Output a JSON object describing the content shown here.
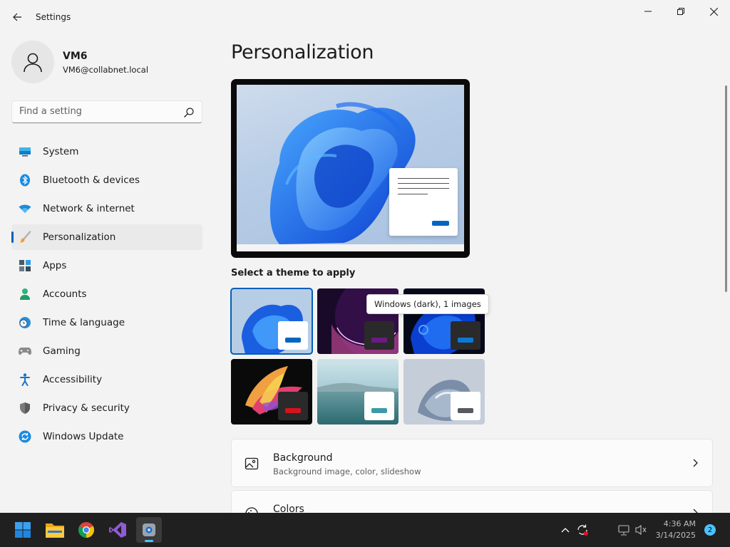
{
  "window": {
    "title": "Settings"
  },
  "profile": {
    "name": "VM6",
    "email": "VM6@collabnet.local"
  },
  "search": {
    "placeholder": "Find a setting"
  },
  "sidebar": {
    "items": [
      {
        "label": "System",
        "icon": "monitor-icon"
      },
      {
        "label": "Bluetooth & devices",
        "icon": "bluetooth-icon"
      },
      {
        "label": "Network & internet",
        "icon": "wifi-icon"
      },
      {
        "label": "Personalization",
        "icon": "brush-icon",
        "active": true
      },
      {
        "label": "Apps",
        "icon": "apps-icon"
      },
      {
        "label": "Accounts",
        "icon": "person-icon"
      },
      {
        "label": "Time & language",
        "icon": "globe-clock-icon"
      },
      {
        "label": "Gaming",
        "icon": "gamepad-icon"
      },
      {
        "label": "Accessibility",
        "icon": "accessibility-icon"
      },
      {
        "label": "Privacy & security",
        "icon": "shield-icon"
      },
      {
        "label": "Windows Update",
        "icon": "update-icon"
      }
    ]
  },
  "main": {
    "title": "Personalization",
    "theme_section_label": "Select a theme to apply",
    "tooltip": "Windows (dark), 1 images",
    "themes": [
      {
        "name": "windows-light",
        "accent": "#0067c0",
        "selected": true
      },
      {
        "name": "glow",
        "accent": "#6b1a86"
      },
      {
        "name": "windows-dark",
        "accent": "#0a79d6"
      },
      {
        "name": "captured-motion",
        "accent": "#d4131a"
      },
      {
        "name": "sunrise",
        "accent": "#3d9aa8"
      },
      {
        "name": "flow",
        "accent": "#565a60"
      }
    ],
    "cards": [
      {
        "title": "Background",
        "subtitle": "Background image, color, slideshow",
        "icon": "image-icon"
      },
      {
        "title": "Colors",
        "subtitle": "",
        "icon": "palette-icon"
      }
    ]
  },
  "taskbar": {
    "apps": [
      "start-icon",
      "file-explorer-icon",
      "chrome-icon",
      "visual-studio-icon",
      "settings-icon"
    ],
    "time": "4:36 AM",
    "date": "3/14/2025",
    "notification_count": "2"
  },
  "colors": {
    "accent": "#005fb8",
    "taskbar": "#202020"
  }
}
